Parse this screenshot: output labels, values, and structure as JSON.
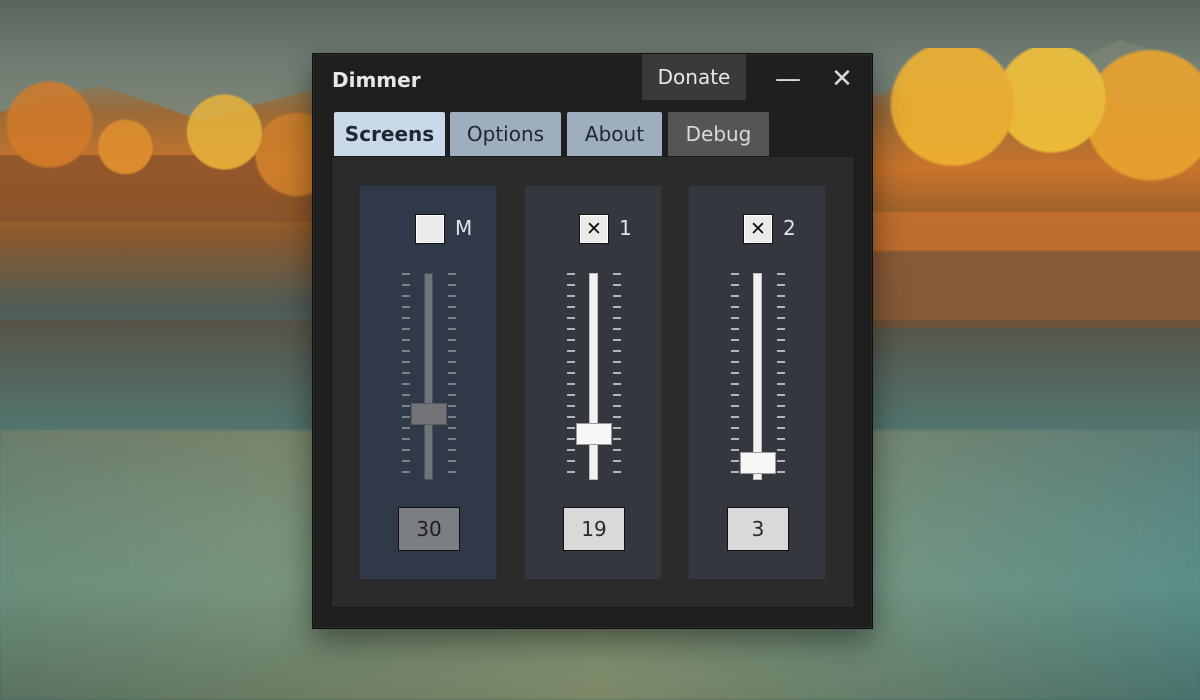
{
  "window": {
    "title": "Dimmer",
    "donate_label": "Donate",
    "minimize_icon": "minimize-icon",
    "close_icon": "close-icon"
  },
  "tabs": [
    {
      "label": "Screens",
      "active": true
    },
    {
      "label": "Options",
      "active": false
    },
    {
      "label": "About",
      "active": false
    },
    {
      "label": "Debug",
      "active": false
    }
  ],
  "screens": [
    {
      "label": "M",
      "checked": false,
      "value": "30",
      "slider_percent": 30
    },
    {
      "label": "1",
      "checked": true,
      "value": "19",
      "slider_percent": 19
    },
    {
      "label": "2",
      "checked": true,
      "value": "3",
      "slider_percent": 3
    }
  ],
  "colors": {
    "active_tab": "#c9d9ea",
    "inactive_tab": "#9faebe",
    "debug_tab": "#555555",
    "window_bg": "#1f1f1f"
  }
}
